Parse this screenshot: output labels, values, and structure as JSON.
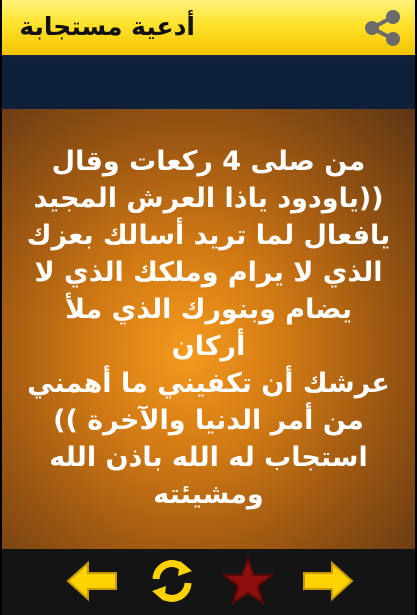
{
  "header": {
    "title": "أدعية مستجابة",
    "share_icon": "share-icon"
  },
  "content": {
    "prayer_text": "من صلى 4 ركعات وقال\n((ياودود ياذا العرش المجيد\nيافعال لما تريد أسالك بعزك\nالذي لا يرام وملكك الذي لا\nيضام وبنورك الذي ملأ أركان\nعرشك أن تكفيني ما أهمني\nمن أمر الدنيا والآخرة ))\nاستجاب له الله باذن الله\nومشيئته"
  },
  "toolbar": {
    "icons": [
      "arrow-left-icon",
      "refresh-icon",
      "star-icon",
      "arrow-right-icon"
    ]
  },
  "colors": {
    "header_yellow": "#ffe22b",
    "band_navy": "#0e1f3a",
    "content_orange": "#d27a14",
    "icon_yellow": "#ffd200",
    "star_red": "#8b0f0f"
  }
}
